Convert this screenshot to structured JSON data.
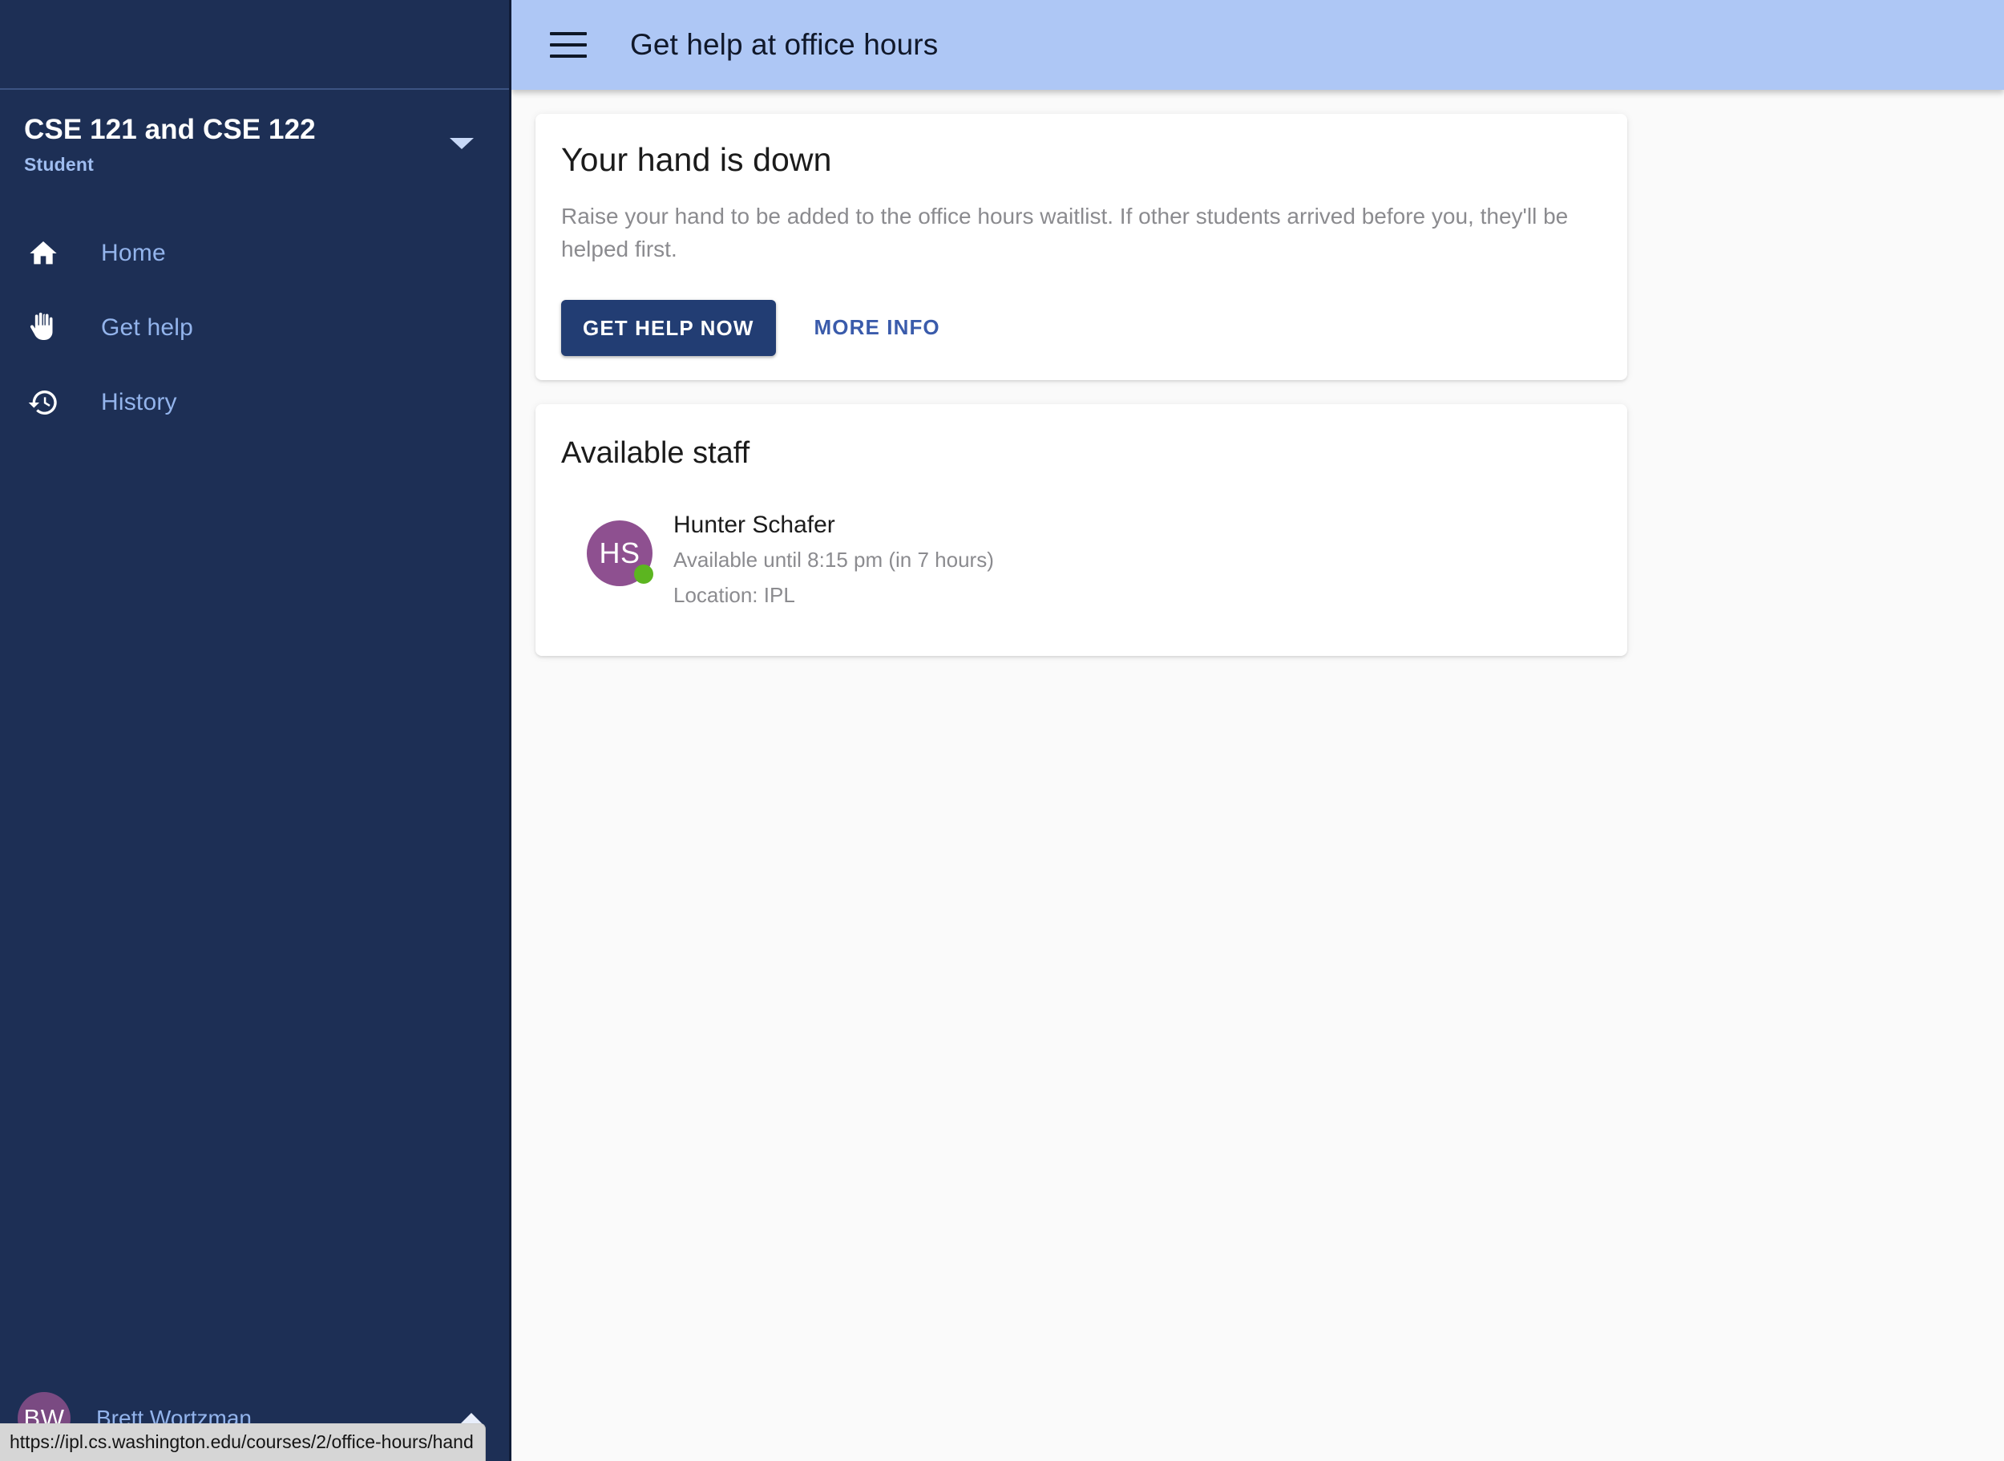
{
  "sidebar": {
    "course": {
      "name": "CSE 121 and CSE 122",
      "role": "Student",
      "chevron_icon": "chevron-down-icon"
    },
    "nav": [
      {
        "label": "Home",
        "icon": "home-icon"
      },
      {
        "label": "Get help",
        "icon": "raised-hand-icon"
      },
      {
        "label": "History",
        "icon": "history-clock-icon"
      }
    ],
    "user": {
      "initials": "BW",
      "name": "Brett Wortzman",
      "chevron_icon": "chevron-up-icon"
    }
  },
  "appbar": {
    "menu_icon": "hamburger-menu-icon",
    "title": "Get help at office hours"
  },
  "hand_card": {
    "title": "Your hand is down",
    "body": "Raise your hand to be added to the office hours waitlist. If other students arrived before you, they'll be helped first.",
    "primary_button": "GET HELP NOW",
    "secondary_button": "MORE INFO"
  },
  "staff_card": {
    "title": "Available staff",
    "staff": [
      {
        "initials": "HS",
        "name": "Hunter Schafer",
        "availability": "Available until 8:15 pm (in 7 hours)",
        "location": "Location: IPL",
        "status": "online"
      }
    ]
  },
  "status_bar": {
    "url": "https://ipl.cs.washington.edu/courses/2/office-hours/hand"
  },
  "colors": {
    "sidebar_bg": "#1d2f55",
    "appbar_bg": "#aec7f5",
    "primary_button": "#223d73",
    "link_blue": "#3a5bab",
    "nav_label": "#93b4ec",
    "avatar_purple": "#8e5090",
    "online_green": "#5cb520",
    "content_bg": "#fafafa"
  }
}
